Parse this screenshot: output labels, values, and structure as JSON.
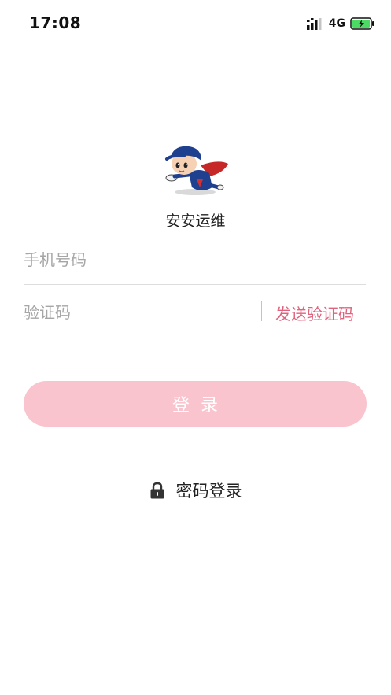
{
  "status_bar": {
    "time": "17:08",
    "network": "4G",
    "icons": [
      "signal-icon",
      "battery-charging-icon"
    ]
  },
  "app": {
    "name": "安安运维",
    "logo_icon": "mascot-logo"
  },
  "form": {
    "phone_placeholder": "手机号码",
    "code_placeholder": "验证码",
    "send_code_label": "发送验证码",
    "login_label": "登录"
  },
  "alt_login": {
    "icon": "lock-icon",
    "label": "密码登录"
  },
  "colors": {
    "accent": "#e0637e",
    "button_bg": "#f9c4cd",
    "battery_fill": "#4cd964"
  }
}
